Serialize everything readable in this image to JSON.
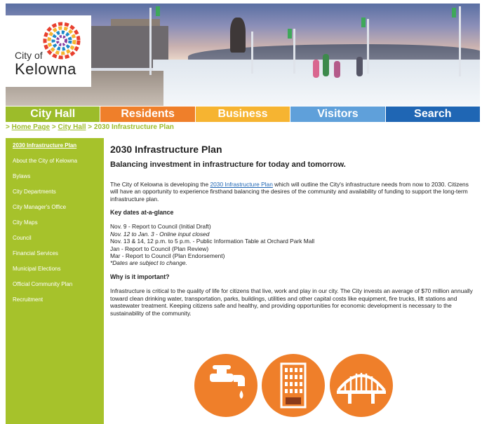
{
  "logo": {
    "city_of": "City of",
    "name": "Kelowna"
  },
  "nav": {
    "tabs": [
      {
        "label": "City Hall",
        "color": "#9cbc2a"
      },
      {
        "label": "Residents",
        "color": "#ef7f2a"
      },
      {
        "label": "Business",
        "color": "#f6b431"
      },
      {
        "label": "Visitors",
        "color": "#5fa0da"
      },
      {
        "label": "Search",
        "color": "#1f66b4"
      }
    ]
  },
  "breadcrumb": {
    "sep": ">",
    "home": "Home Page",
    "cityhall": "City Hall",
    "current": "2030 Infrastructure Plan"
  },
  "sidebar": {
    "items": [
      {
        "label": "2030 Infrastructure Plan"
      },
      {
        "label": "About the City of Kelowna"
      },
      {
        "label": "Bylaws"
      },
      {
        "label": "City Departments"
      },
      {
        "label": "City Manager's Office"
      },
      {
        "label": "City Maps"
      },
      {
        "label": "Council"
      },
      {
        "label": "Financial Services"
      },
      {
        "label": "Municipal Elections"
      },
      {
        "label": "Official Community Plan"
      },
      {
        "label": "Recruitment"
      }
    ]
  },
  "main": {
    "title": "2030 Infrastructure Plan",
    "subtitle": "Balancing investment in infrastructure for today and tomorrow.",
    "intro_before": "The City of Kelowna is developing the ",
    "intro_link": "2030 Infrastructure Plan",
    "intro_after": " which will outline the City's infrastructure needs from now to 2030. Citizens will have an opportunity to experience firsthand balancing the desires of the community and availability of funding to support the long-term infrastructure plan.",
    "key_dates_heading": "Key dates at-a-glance",
    "dates": [
      {
        "text": "Nov. 9 - Report to Council (Initial Draft)",
        "italic": false
      },
      {
        "text": "Nov. 12 to Jan. 3 - Online input closed",
        "italic": true
      },
      {
        "text": "Nov. 13 & 14, 12 p.m. to 5 p.m. - Public Information Table at Orchard Park Mall",
        "italic": false
      },
      {
        "text": "Jan - Report to Council (Plan Review)",
        "italic": false
      },
      {
        "text": "Mar - Report to Council (Plan Endorsement)",
        "italic": false
      },
      {
        "text": "*Dates are subject to change.",
        "italic": true
      }
    ],
    "why_heading": "Why is it important?",
    "why_text": "Infrastructure is critical to the quality of life for citizens that live, work and play in our city. The City invests an average of $70 million annually toward clean drinking water, transportation, parks, buildings, utilities and other capital costs like equipment, fire trucks, lift stations and wastewater treatment. Keeping citizens safe and healthy, and providing opportunities for economic development is necessary to the sustainability of the community."
  },
  "icons": [
    "water-tap-icon",
    "building-icon",
    "bridge-icon"
  ],
  "colors": {
    "green": "#a6c22b",
    "orange": "#ef7f2a",
    "link": "#1f66b4"
  }
}
